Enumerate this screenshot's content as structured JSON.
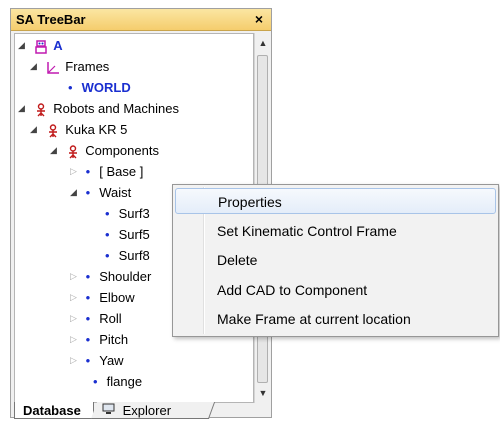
{
  "panel": {
    "title": "SA TreeBar",
    "close_label": "×"
  },
  "tree": {
    "items": [
      {
        "label": "A",
        "icon": "robot-icon"
      },
      {
        "label": "Frames",
        "icon": "frame-icon"
      },
      {
        "label": "WORLD"
      },
      {
        "label": "Robots and Machines",
        "icon": "robot-icon"
      },
      {
        "label": "Kuka KR 5",
        "icon": "robot-icon"
      },
      {
        "label": "Components",
        "icon": "robot-icon"
      },
      {
        "label": "[ Base ]"
      },
      {
        "label": "Waist"
      },
      {
        "label": "Surf3"
      },
      {
        "label": "Surf5"
      },
      {
        "label": "Surf8"
      },
      {
        "label": "Shoulder"
      },
      {
        "label": "Elbow"
      },
      {
        "label": "Roll"
      },
      {
        "label": "Pitch"
      },
      {
        "label": "Yaw"
      },
      {
        "label": "flange"
      }
    ]
  },
  "tabs": {
    "database": "Database",
    "explorer": "Explorer"
  },
  "context_menu": {
    "items": [
      "Properties",
      "Set Kinematic Control Frame",
      "Delete",
      "Add CAD to Component",
      "Make Frame at current location"
    ]
  },
  "colors": {
    "tree_label_accent": "#1a2fd0",
    "title_bar": "#f5cd6d",
    "menu_highlight": "#e4edf9"
  }
}
